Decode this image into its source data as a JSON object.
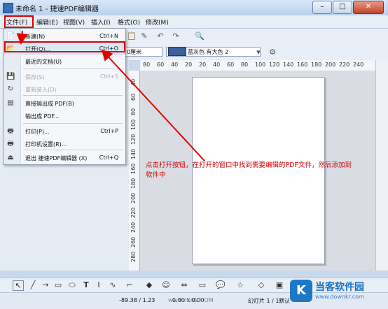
{
  "window": {
    "title": "未命名 1 - 捷速PDF编辑器",
    "controls": [
      "–",
      "□",
      "✕"
    ]
  },
  "menubar": [
    "文件(F)",
    "编辑(E)",
    "视图(V)",
    "插入(I)",
    "格式(O)",
    "修改(M)"
  ],
  "toolbar2": {
    "line_width": "0厘米",
    "color_label": "蓝灰色 有大色 2"
  },
  "ruler_h": [
    "80",
    "60",
    "40",
    "20",
    "20",
    "40",
    "60",
    "80",
    "100",
    "120",
    "140",
    "160",
    "180",
    "200",
    "220",
    "240"
  ],
  "ruler_v": [
    "40",
    "60",
    "80",
    "100",
    "120",
    "140",
    "160",
    "180",
    "200",
    "220",
    "240",
    "260",
    "280"
  ],
  "file_menu": [
    {
      "icon": "new-doc-icon",
      "glyph": "📄",
      "label": "新建(N)",
      "shortcut": "Ctrl+N",
      "disabled": false
    },
    {
      "icon": "open-folder-icon",
      "glyph": "📂",
      "label": "打开(O)...",
      "shortcut": "Ctrl+O",
      "disabled": false
    },
    {
      "icon": "",
      "glyph": "",
      "label": "最近的文档(U)",
      "shortcut": "",
      "disabled": false
    },
    {
      "icon": "save-icon",
      "glyph": "💾",
      "label": "保存(S)",
      "shortcut": "Ctrl+S",
      "disabled": true
    },
    {
      "icon": "reload-icon",
      "glyph": "↻",
      "label": "重新装入(D)",
      "shortcut": "",
      "disabled": true
    },
    {
      "icon": "export-pdf-icon",
      "glyph": "▤",
      "label": "直接输出成 PDF(B)",
      "shortcut": "",
      "disabled": false
    },
    {
      "icon": "",
      "glyph": "",
      "label": "输出成 PDF...",
      "shortcut": "",
      "disabled": false
    },
    {
      "icon": "printer-icon",
      "glyph": "🖶",
      "label": "打印(P)...",
      "shortcut": "Ctrl+P",
      "disabled": false
    },
    {
      "icon": "printer-setup-icon",
      "glyph": "🖶",
      "label": "打印机设置(R)...",
      "shortcut": "",
      "disabled": false
    },
    {
      "icon": "exit-icon",
      "glyph": "⏏",
      "label": "退出 捷速PDF编辑器 (X)",
      "shortcut": "Ctrl+Q",
      "disabled": false
    }
  ],
  "annotation": "点击打开按钮，在打开的窗口中找到需要编辑的PDF文件，然后添加到软件中",
  "status": {
    "coords": "-89.38 / 1.23",
    "size": "0.00 x 0.00",
    "slide": "幻灯片 1 / 1",
    "layout": "默认"
  },
  "watermark": {
    "logo_char": "K",
    "name": "当客软件园",
    "url": "www.downkr.com",
    "mid": "www.YXAN.COM"
  }
}
